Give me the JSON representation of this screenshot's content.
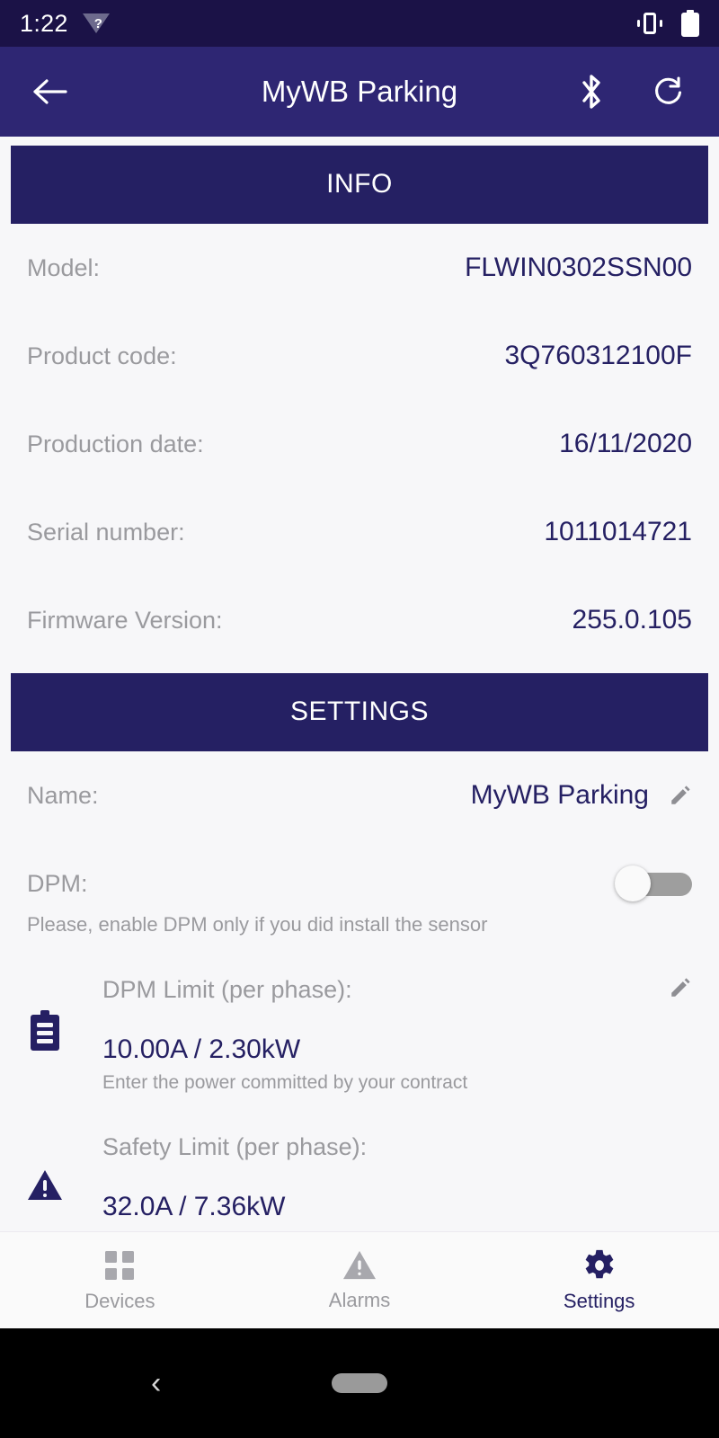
{
  "status_bar": {
    "time": "1:22",
    "wifi_icon": "wifi-unknown-icon",
    "vibrate_icon": "vibrate-icon",
    "battery_icon": "battery-full-icon"
  },
  "app_bar": {
    "back_icon": "back-arrow-icon",
    "title": "MyWB Parking",
    "bluetooth_icon": "bluetooth-icon",
    "refresh_icon": "refresh-icon"
  },
  "info": {
    "header": "INFO",
    "rows": [
      {
        "label": "Model:",
        "value": "FLWIN0302SSN00"
      },
      {
        "label": "Product code:",
        "value": "3Q760312100F"
      },
      {
        "label": "Production date:",
        "value": "16/11/2020"
      },
      {
        "label": "Serial number:",
        "value": "1011014721"
      },
      {
        "label": "Firmware Version:",
        "value": "255.0.105"
      }
    ]
  },
  "settings": {
    "header": "SETTINGS",
    "name_row": {
      "label": "Name:",
      "value": "MyWB Parking",
      "edit_icon": "pencil-icon"
    },
    "dpm_row": {
      "label": "DPM:",
      "toggle_state": "off",
      "hint": "Please, enable DPM only if you did install the sensor"
    },
    "dpm_limit": {
      "icon": "clipboard-icon",
      "title": "DPM Limit (per phase):",
      "value": "10.00A / 2.30kW",
      "sub": "Enter the power committed by your contract",
      "edit_icon": "pencil-icon"
    },
    "safety_limit": {
      "icon": "warning-triangle-icon",
      "title": "Safety Limit (per phase):",
      "value": "32.0A / 7.36kW"
    }
  },
  "bottom_nav": {
    "items": [
      {
        "label": "Devices",
        "icon": "grid-icon",
        "active": false
      },
      {
        "label": "Alarms",
        "icon": "warning-triangle-icon",
        "active": false
      },
      {
        "label": "Settings",
        "icon": "gear-icon",
        "active": true
      }
    ]
  },
  "system_nav": {
    "back_icon": "system-back-icon",
    "home_pill": "home-pill-icon"
  },
  "colors": {
    "status_bar": "#1b1247",
    "app_bar": "#2e2673",
    "section_header": "#252063",
    "accent": "#252063",
    "muted_text": "#9a9a9e",
    "background": "#f7f7f9"
  }
}
